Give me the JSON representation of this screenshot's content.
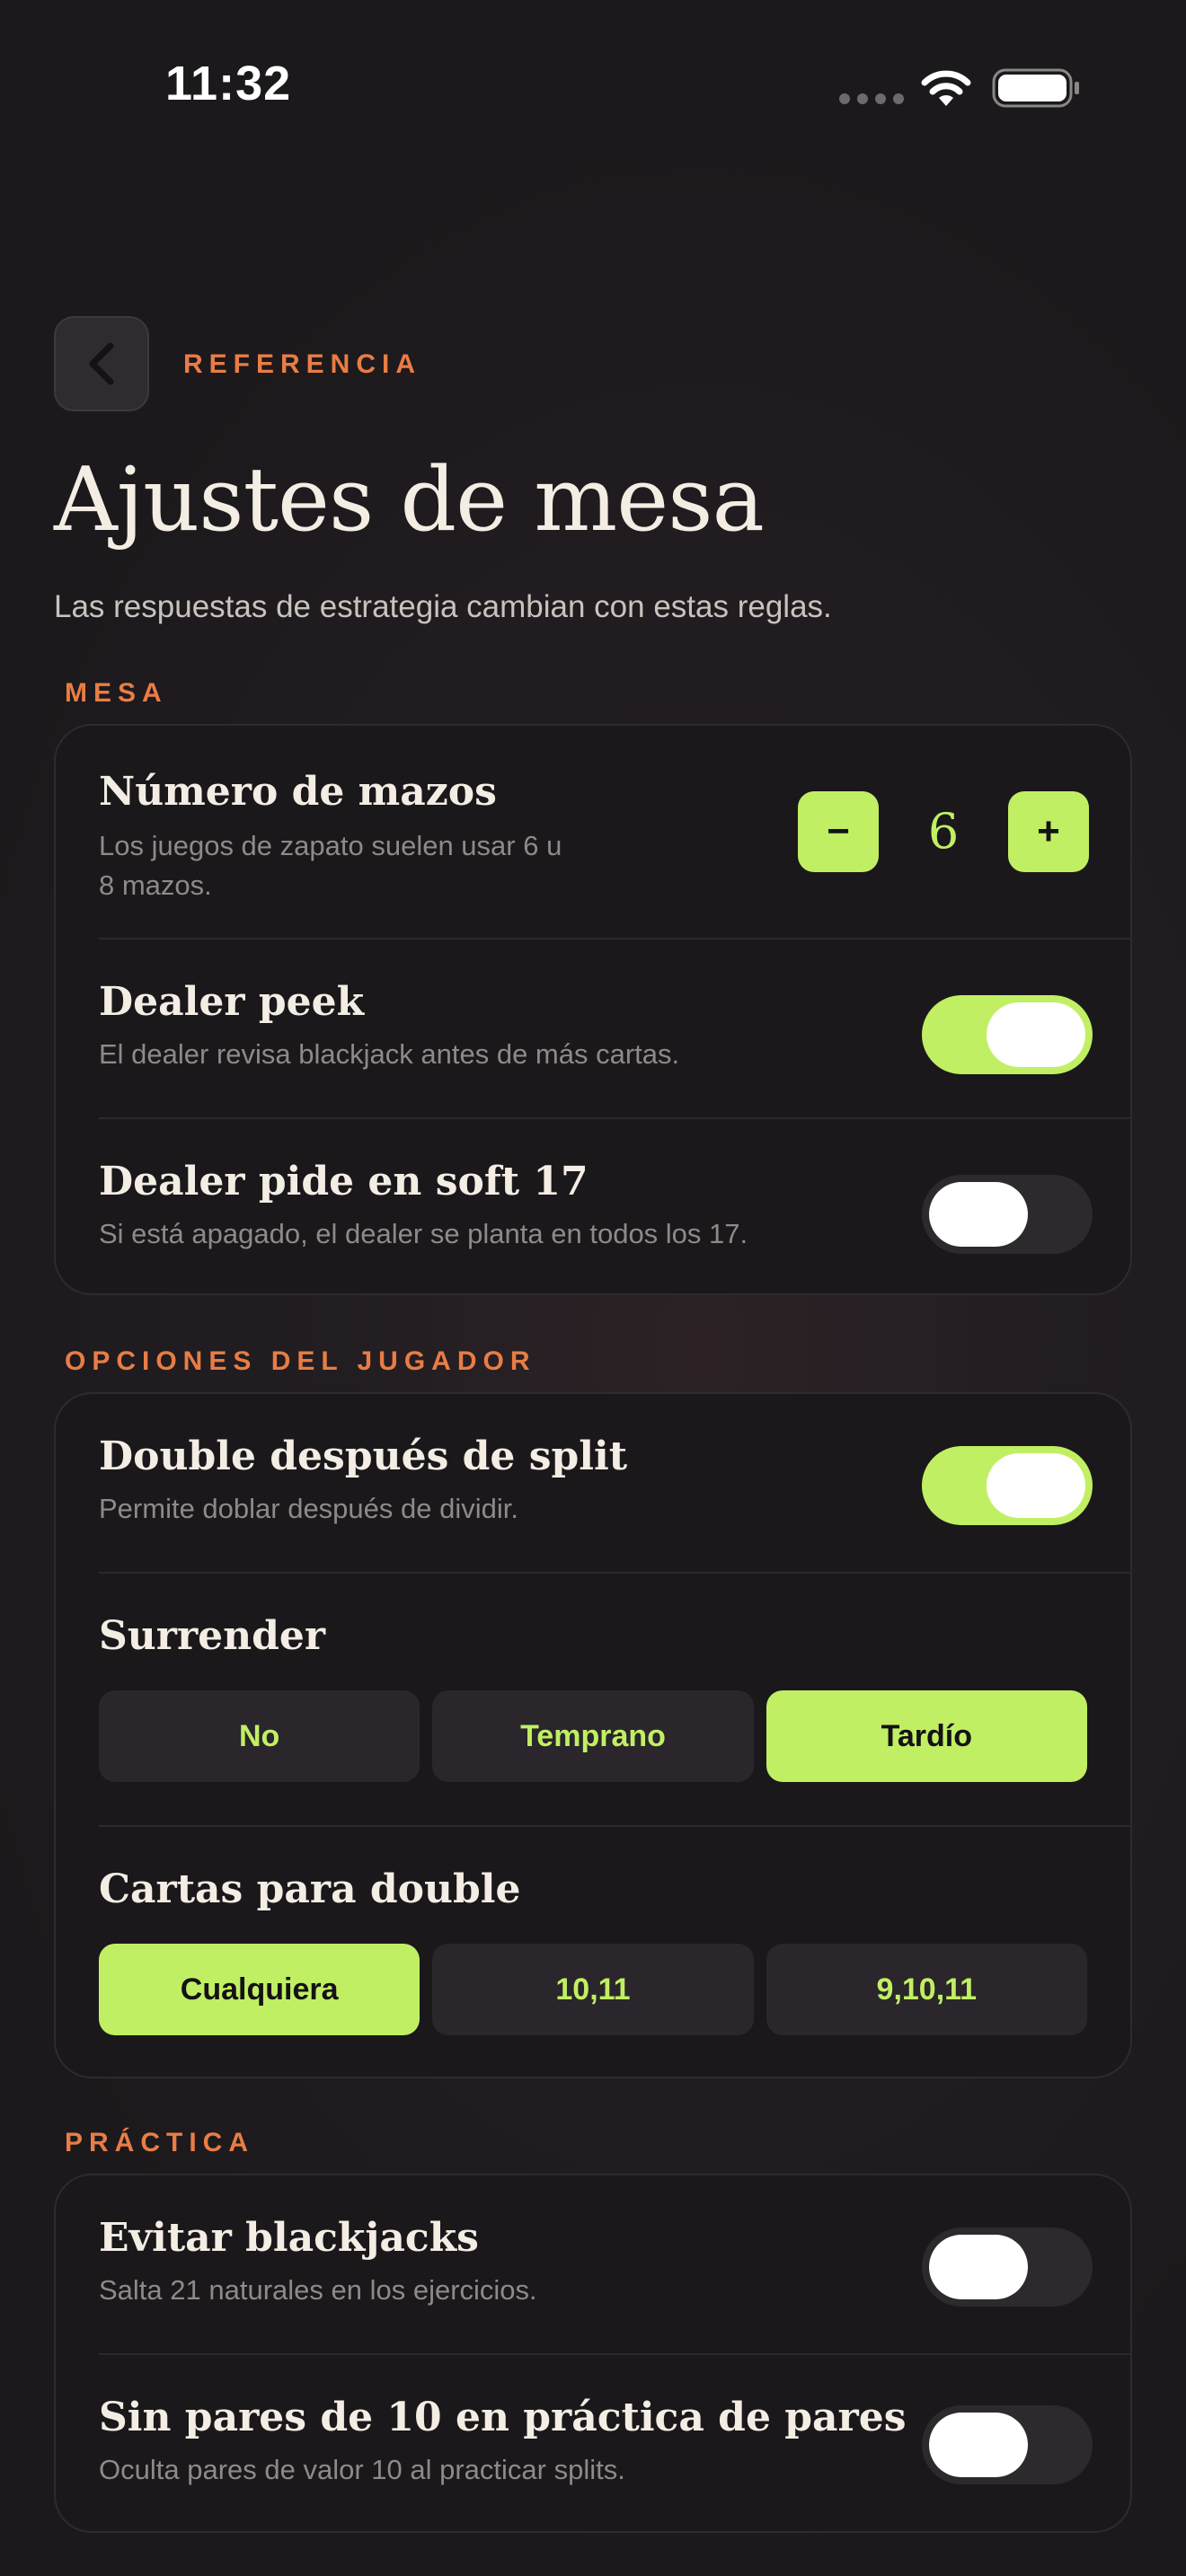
{
  "status_bar": {
    "time": "11:32"
  },
  "header": {
    "eyebrow": "REFERENCIA",
    "title": "Ajustes de mesa",
    "subtitle": "Las respuestas de estrategia cambian con estas reglas."
  },
  "sections": {
    "mesa": {
      "label": "MESA",
      "decks": {
        "title": "Número de mazos",
        "desc_line1": "Los juegos de zapato suelen usar 6 u",
        "desc_line2": "8 mazos.",
        "value": "6",
        "minus": "−",
        "plus": "+"
      },
      "peek": {
        "title": "Dealer peek",
        "desc": "El dealer revisa blackjack antes de más cartas.",
        "on": true
      },
      "h17": {
        "title": "Dealer pide en soft 17",
        "desc": "Si está apagado, el dealer se planta en todos los 17.",
        "on": false
      }
    },
    "jugador": {
      "label": "OPCIONES DEL JUGADOR",
      "das": {
        "title": "Double después de split",
        "desc": "Permite doblar después de dividir.",
        "on": true
      },
      "surrender": {
        "title": "Surrender",
        "options": [
          "No",
          "Temprano",
          "Tardío"
        ],
        "selected": "Tardío"
      },
      "double_cards": {
        "title": "Cartas para double",
        "options": [
          "Cualquiera",
          "10,11",
          "9,10,11"
        ],
        "selected": "Cualquiera"
      }
    },
    "practica": {
      "label": "PRÁCTICA",
      "avoid_bj": {
        "title": "Evitar blackjacks",
        "desc": "Salta 21 naturales en los ejercicios.",
        "on": false
      },
      "no_ten_pairs": {
        "title": "Sin pares de 10 en práctica de pares",
        "desc": "Oculta pares de valor 10 al practicar splits.",
        "on": false
      }
    }
  },
  "colors": {
    "accent": "#c1ef63",
    "eyebrow": "#e87d45",
    "background": "#1f1b1f"
  }
}
